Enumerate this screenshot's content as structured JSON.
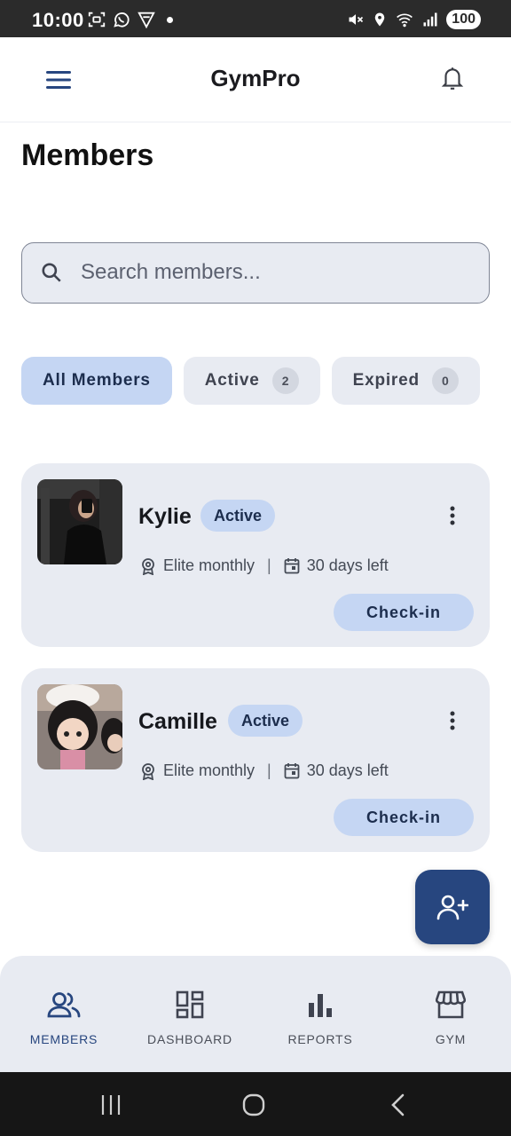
{
  "status_bar": {
    "time": "10:00",
    "battery": "100",
    "icons": [
      "screenshot-icon",
      "whatsapp-icon",
      "vpn-icon",
      "notification-dot",
      "mute-icon",
      "location-icon",
      "wifi-icon",
      "signal-icon"
    ]
  },
  "app_bar": {
    "title": "GymPro",
    "left_icon": "menu-icon",
    "right_icon": "bell-icon"
  },
  "page": {
    "title": "Members"
  },
  "search": {
    "placeholder": "Search members...",
    "value": ""
  },
  "filters": [
    {
      "label": "All Members",
      "selected": true
    },
    {
      "label": "Active",
      "count": "2",
      "selected": false
    },
    {
      "label": "Expired",
      "count": "0",
      "selected": false
    }
  ],
  "members": [
    {
      "name": "Kylie",
      "status": "Active",
      "plan": "Elite monthly",
      "remaining": "30 days left",
      "action": "Check-in"
    },
    {
      "name": "Camille",
      "status": "Active",
      "plan": "Elite monthly",
      "remaining": "30 days left",
      "action": "Check-in"
    }
  ],
  "fab": {
    "icon": "add-person-icon"
  },
  "bottom_nav": [
    {
      "label": "MEMBERS",
      "icon": "members-icon",
      "active": true
    },
    {
      "label": "DASHBOARD",
      "icon": "dashboard-icon",
      "active": false
    },
    {
      "label": "REPORTS",
      "icon": "reports-icon",
      "active": false
    },
    {
      "label": "GYM",
      "icon": "store-icon",
      "active": false
    }
  ],
  "colors": {
    "primary": "#27467f",
    "chip_selected": "#c5d6f3",
    "surface": "#e8ebf2"
  }
}
